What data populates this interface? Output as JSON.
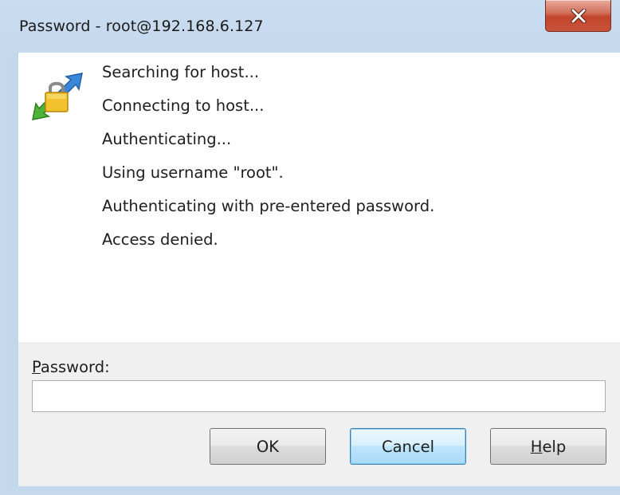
{
  "window": {
    "title": "Password - root@192.168.6.127"
  },
  "icons": {
    "app_icon": "lock-with-arrows-icon",
    "close_icon": "close-icon"
  },
  "log": {
    "lines": [
      "Searching for host...",
      "Connecting to host...",
      "Authenticating...",
      "Using username \"root\".",
      "Authenticating with pre-entered password.",
      "Access denied."
    ]
  },
  "form": {
    "password_label_accel": "P",
    "password_label_rest": "assword:",
    "password_value": ""
  },
  "buttons": {
    "ok": "OK",
    "cancel": "Cancel",
    "help_accel": "H",
    "help_rest": "elp"
  },
  "colors": {
    "close_button": "#c8543b",
    "default_button_border": "#3c7fb1",
    "form_background": "#f0f0f0"
  }
}
